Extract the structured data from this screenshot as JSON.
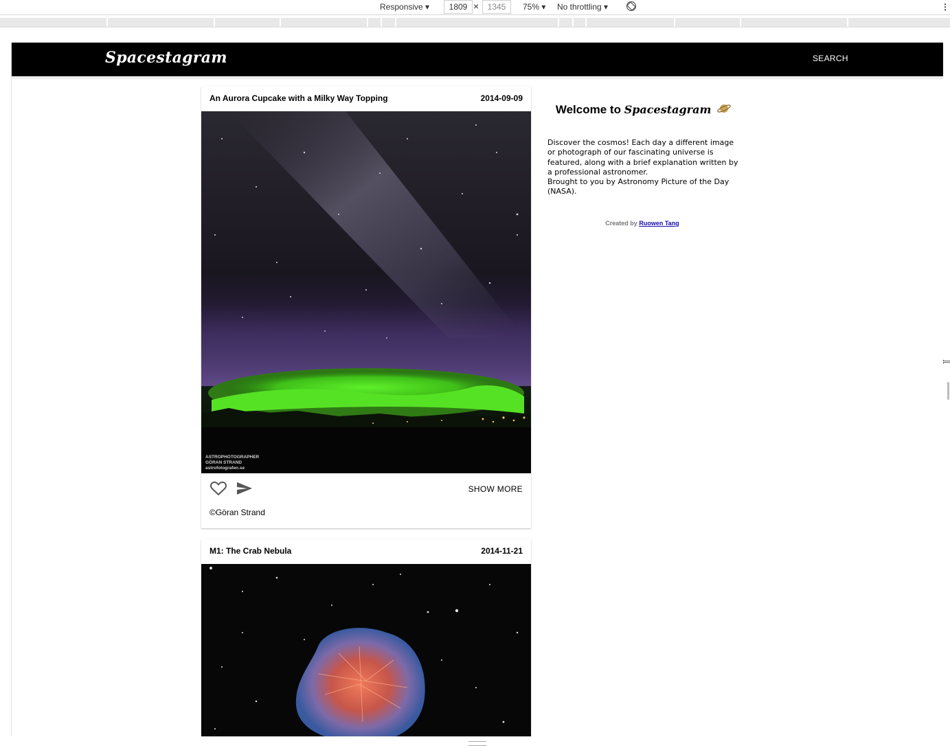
{
  "devtools": {
    "device_mode": "Responsive ▾",
    "width": "1809",
    "times": "×",
    "height": "1345",
    "zoom": "75% ▾",
    "throttling": "No throttling ▾",
    "more": "⋮"
  },
  "app": {
    "logo": "Spacestagram",
    "search_label": "SEARCH"
  },
  "posts": [
    {
      "title": "An Aurora Cupcake with a Milky Way Topping",
      "date": "2014-09-09",
      "watermark": [
        "ASTROPHOTOGRAPHER",
        "GÖRAN STRAND",
        "astrofotografen.se"
      ],
      "show_more_label": "SHOW MORE",
      "copyright": "©Göran Strand"
    },
    {
      "title": "M1: The Crab Nebula",
      "date": "2014-11-21"
    }
  ],
  "sidebar": {
    "welcome_prefix": "Welcome to",
    "welcome_brand": "Spacestagram",
    "about_line1": "Discover the cosmos! Each day a different image or photograph of our fascinating universe is featured, along with a brief explanation written by a professional astronomer.",
    "about_line2": "Brought to you by Astronomy Picture of the Day (NASA).",
    "credit_prefix": "Created by",
    "credit_name": "Ruowen Tang"
  },
  "colors": {
    "appbar": "#000000",
    "aurora": "#4fd21a",
    "link": "#1a0dab"
  },
  "icons": {
    "like": "heart-outline-icon",
    "share": "send-icon",
    "planet": "saturn-icon",
    "rotate": "rotate-icon"
  }
}
